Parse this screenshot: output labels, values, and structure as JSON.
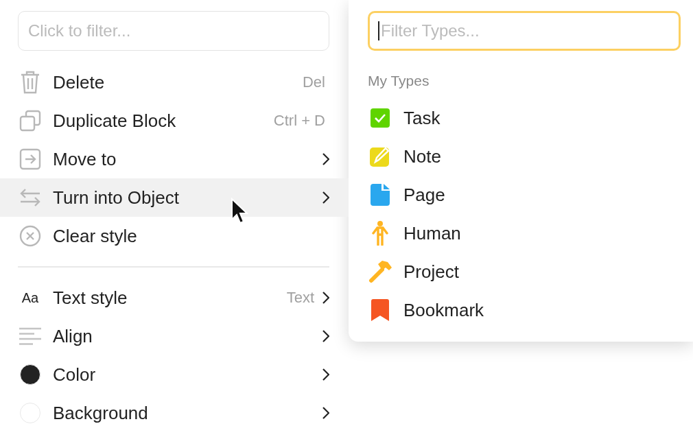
{
  "menu": {
    "filter": {
      "placeholder": "Click to filter..."
    },
    "items": [
      {
        "kind": "trash",
        "label": "Delete",
        "shortcut": "Del",
        "submenu": false,
        "selected": false
      },
      {
        "kind": "duplicate",
        "label": "Duplicate Block",
        "shortcut": "Ctrl + D",
        "submenu": false,
        "selected": false
      },
      {
        "kind": "move",
        "label": "Move to",
        "submenu": true,
        "selected": false
      },
      {
        "kind": "convert",
        "label": "Turn into Object",
        "submenu": true,
        "selected": true
      },
      {
        "kind": "clear",
        "label": "Clear style",
        "submenu": false,
        "selected": false
      }
    ],
    "style_items": [
      {
        "kind": "text",
        "icon_text": "Aa",
        "label": "Text style",
        "hint": "Text",
        "submenu": true,
        "selected": false
      },
      {
        "kind": "align",
        "label": "Align",
        "submenu": true,
        "selected": false
      },
      {
        "kind": "dot",
        "color": "#222222",
        "label": "Color",
        "submenu": true,
        "selected": false
      },
      {
        "kind": "dot",
        "color": "#ffffff",
        "label": "Background",
        "submenu": true,
        "selected": false
      }
    ]
  },
  "types_panel": {
    "filter": {
      "placeholder": "Filter Types...",
      "focused": true
    },
    "heading": "My Types",
    "types": [
      {
        "kind": "task",
        "label": "Task",
        "color": "#5fd400"
      },
      {
        "kind": "note",
        "label": "Note",
        "color": "#ecd91b"
      },
      {
        "kind": "page",
        "label": "Page",
        "color": "#2aa7ee"
      },
      {
        "kind": "human",
        "label": "Human",
        "color": "#ffb522"
      },
      {
        "kind": "project",
        "label": "Project",
        "color": "#ffb522"
      },
      {
        "kind": "bookmark",
        "label": "Bookmark",
        "color": "#f55522"
      }
    ]
  }
}
